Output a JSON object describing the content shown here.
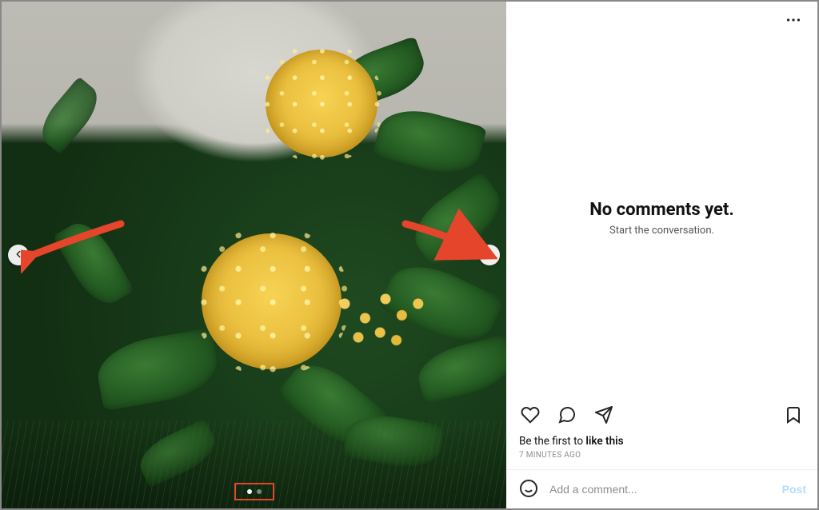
{
  "comments": {
    "empty_title": "No comments yet.",
    "empty_subtitle": "Start the conversation."
  },
  "likes": {
    "prefix": "Be the first to ",
    "emphasis": "like this"
  },
  "timestamp": "7 MINUTES AGO",
  "comment_form": {
    "placeholder": "Add a comment...",
    "post_label": "Post"
  },
  "carousel": {
    "total": 2,
    "active_index": 0
  },
  "annotation": {
    "arrow_color": "#e4452b",
    "highlight_color": "#e4452b"
  }
}
